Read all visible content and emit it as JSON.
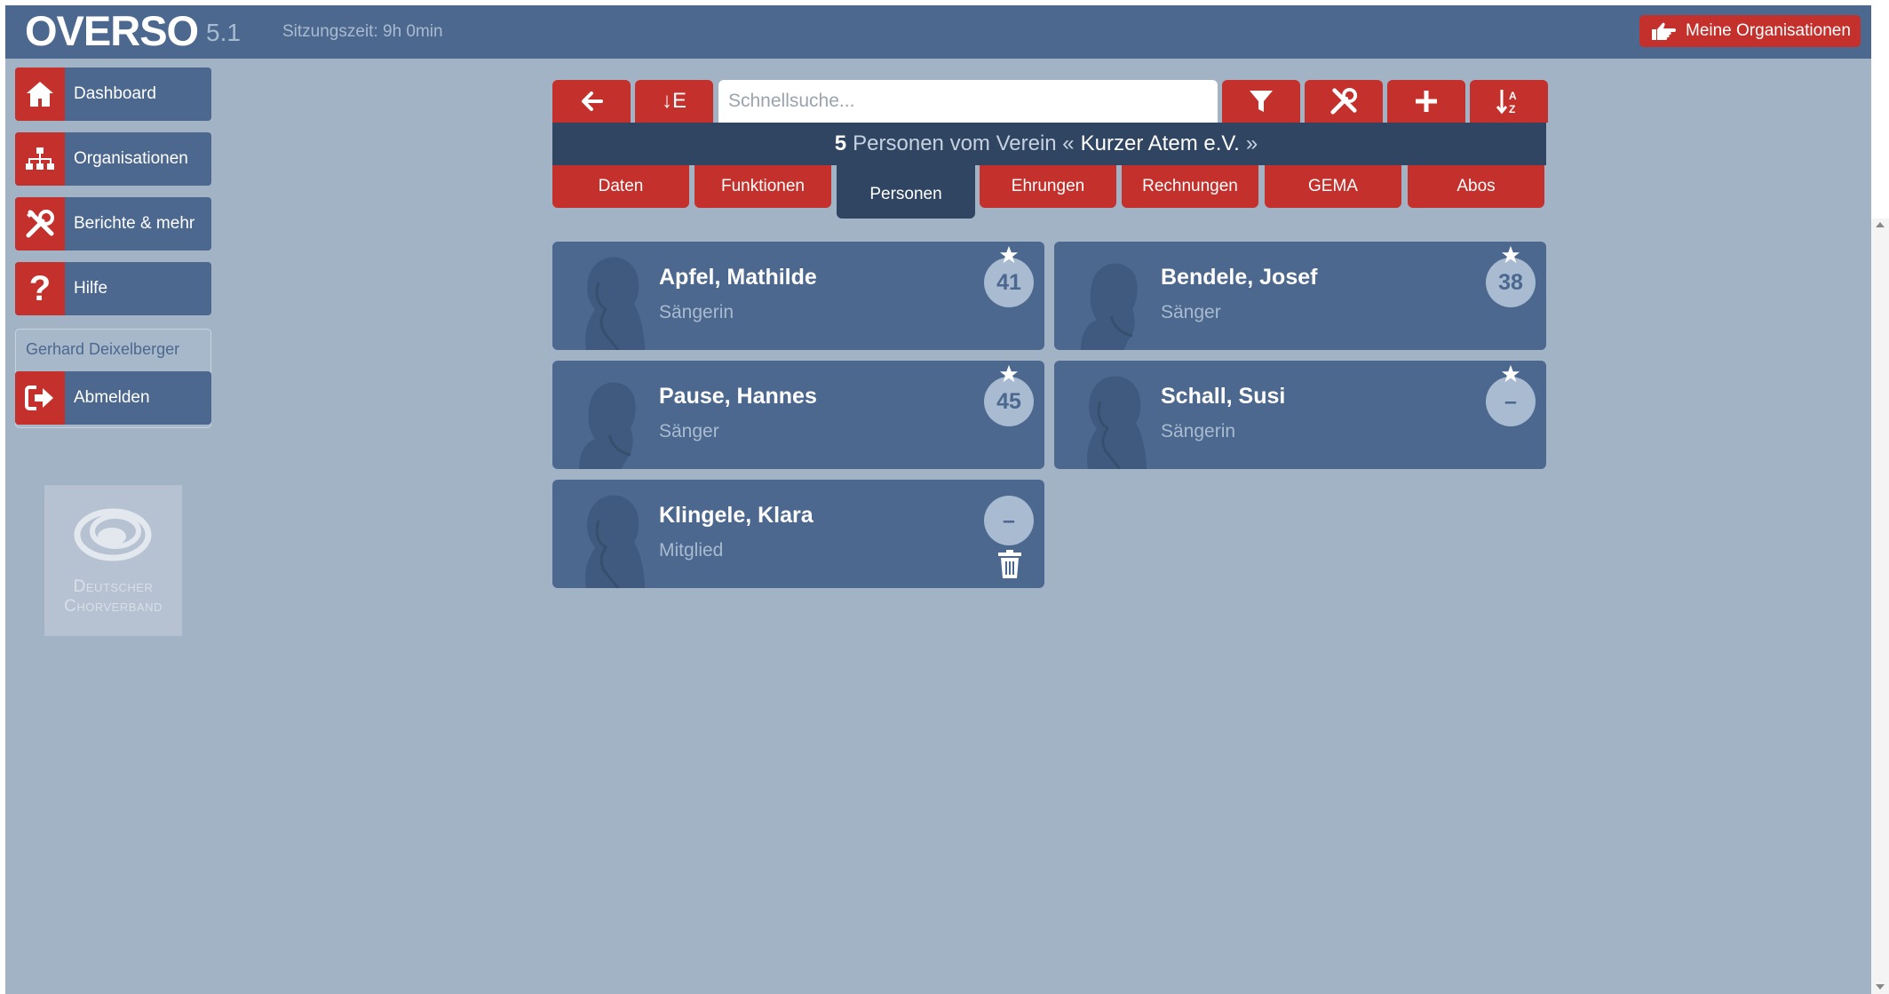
{
  "header": {
    "brand": "OVERSO",
    "version": "5.1",
    "session": "Sitzungszeit: 9h 0min",
    "my_orgs_label": "Meine Organisationen"
  },
  "sidebar": {
    "items": [
      {
        "label": "Dashboard",
        "icon": "home-icon"
      },
      {
        "label": "Organisationen",
        "icon": "sitemap-icon"
      },
      {
        "label": "Berichte & mehr",
        "icon": "tools-icon"
      },
      {
        "label": "Hilfe",
        "icon": "question-icon"
      }
    ],
    "user_name": "Gerhard Deixelberger",
    "logout_label": "Abmelden",
    "logo_text": "Deutscher Chorverband"
  },
  "toolbar": {
    "back_icon": "arrow-left-icon",
    "export_label": "↓E",
    "search_placeholder": "Schnellsuche...",
    "filter_icon": "filter-icon",
    "tools_icon": "tools-icon",
    "add_icon": "plus-icon",
    "sort_icon": "sort-alpha-icon"
  },
  "context": {
    "count": "5",
    "text": "Personen vom Verein «",
    "org_name": "Kurzer Atem e.V.",
    "suffix": "»"
  },
  "tabs": [
    {
      "label": "Daten",
      "active": false
    },
    {
      "label": "Funktionen",
      "active": false
    },
    {
      "label": "Personen",
      "active": true
    },
    {
      "label": "Ehrungen",
      "active": false
    },
    {
      "label": "Rechnungen",
      "active": false
    },
    {
      "label": "GEMA",
      "active": false
    },
    {
      "label": "Abos",
      "active": false
    }
  ],
  "persons": [
    {
      "name": "Apfel, Mathilde",
      "role": "Sängerin",
      "badge": "41",
      "gender": "female",
      "starred": true,
      "deletable": false
    },
    {
      "name": "Bendele, Josef",
      "role": "Sänger",
      "badge": "38",
      "gender": "male",
      "starred": true,
      "deletable": false
    },
    {
      "name": "Pause, Hannes",
      "role": "Sänger",
      "badge": "45",
      "gender": "male",
      "starred": true,
      "deletable": false
    },
    {
      "name": "Schall, Susi",
      "role": "Sängerin",
      "badge": "–",
      "gender": "female",
      "starred": true,
      "deletable": false
    },
    {
      "name": "Klingele, Klara",
      "role": "Mitglied",
      "badge": "–",
      "gender": "female",
      "starred": false,
      "deletable": true
    }
  ],
  "colors": {
    "background": "#a3b3c6",
    "bar": "#4c688e",
    "dark": "#2f4562",
    "accent": "#c4302b",
    "muted": "#a9bbd1"
  }
}
